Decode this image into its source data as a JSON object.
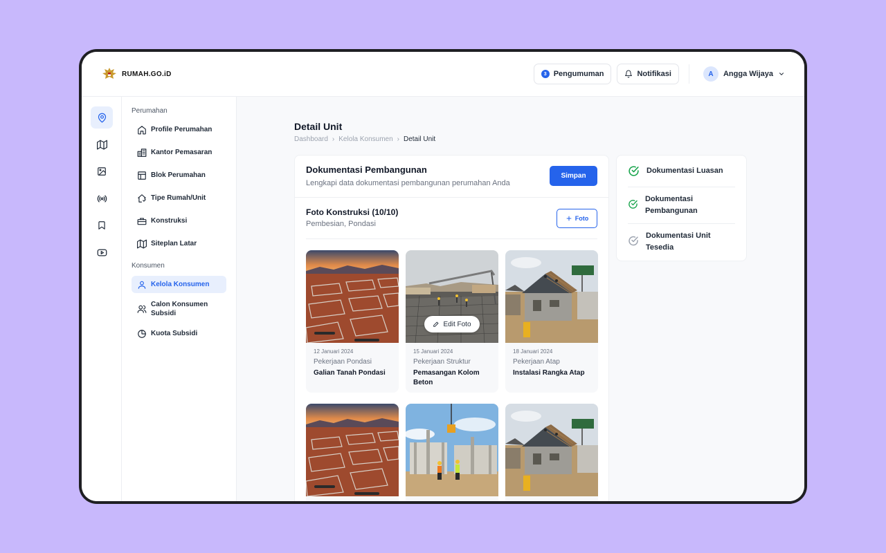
{
  "header": {
    "logo_text": "RUMAH.GO.iD",
    "announcement_label": "Pengumuman",
    "announcement_count": "3",
    "notification_label": "Notifikasi",
    "user_initial": "A",
    "user_name": "Angga Wijaya"
  },
  "rail": {
    "icons": [
      "location-pin-icon",
      "map-icon",
      "image-icon",
      "broadcast-icon",
      "bookmark-icon",
      "video-icon"
    ],
    "active_index": 0
  },
  "sidebar": {
    "group1": "Perumahan",
    "group1_items": [
      {
        "label": "Profile Perumahan",
        "icon": "home-icon"
      },
      {
        "label": "Kantor Pemasaran",
        "icon": "office-icon"
      },
      {
        "label": "Blok Perumahan",
        "icon": "layout-icon"
      },
      {
        "label": "Tipe Rumah/Unit",
        "icon": "house-type-icon"
      },
      {
        "label": "Konstruksi",
        "icon": "toolbox-icon"
      },
      {
        "label": "Siteplan Latar",
        "icon": "siteplan-map-icon"
      }
    ],
    "group2": "Konsumen",
    "group2_items": [
      {
        "label": "Kelola Konsumen",
        "icon": "user-icon",
        "active": true
      },
      {
        "label": "Calon Konsumen Subsidi",
        "icon": "users-icon"
      },
      {
        "label": "Kuota Subsidi",
        "icon": "pie-chart-icon"
      }
    ]
  },
  "page": {
    "title": "Detail Unit",
    "breadcrumb": [
      "Dashboard",
      "Kelola Konsumen",
      "Detail Unit"
    ]
  },
  "card": {
    "title": "Dokumentasi Pembangunan",
    "subtitle": "Lengkapi data dokumentasi pembangunan perumahan Anda",
    "save_label": "Simpan",
    "section_title": "Foto Konstruksi (10/10)",
    "section_sub": "Pembesian, Pondasi",
    "add_photo_label": "Foto",
    "edit_photo_label": "Edit Foto"
  },
  "photos": [
    {
      "date": "12 Januari 2024",
      "category": "Pekerjaan Pondasi",
      "name": "Galian Tanah Pondasi",
      "scene": "foundation"
    },
    {
      "date": "15 Januari 2024",
      "category": "Pekerjaan Struktur",
      "name": "Pemasangan Kolom Beton",
      "scene": "concrete"
    },
    {
      "date": "18 Januari 2024",
      "category": "Pekerjaan Atap",
      "name": "Instalasi Rangka Atap",
      "scene": "roof"
    },
    {
      "date": "",
      "category": "",
      "name": "",
      "scene": "foundation"
    },
    {
      "date": "",
      "category": "",
      "name": "",
      "scene": "columns"
    },
    {
      "date": "",
      "category": "",
      "name": "",
      "scene": "roof"
    }
  ],
  "checklist": [
    {
      "label": "Dokumentasi Luasan",
      "done": true
    },
    {
      "label": "Dokumentasi Pembangunan",
      "done": true
    },
    {
      "label": "Dokumentasi Unit Tesedia",
      "done": false
    }
  ],
  "colors": {
    "accent": "#2563eb",
    "done": "#16a34a",
    "pending": "#9ca3af",
    "backdrop": "#c8b8fc"
  }
}
